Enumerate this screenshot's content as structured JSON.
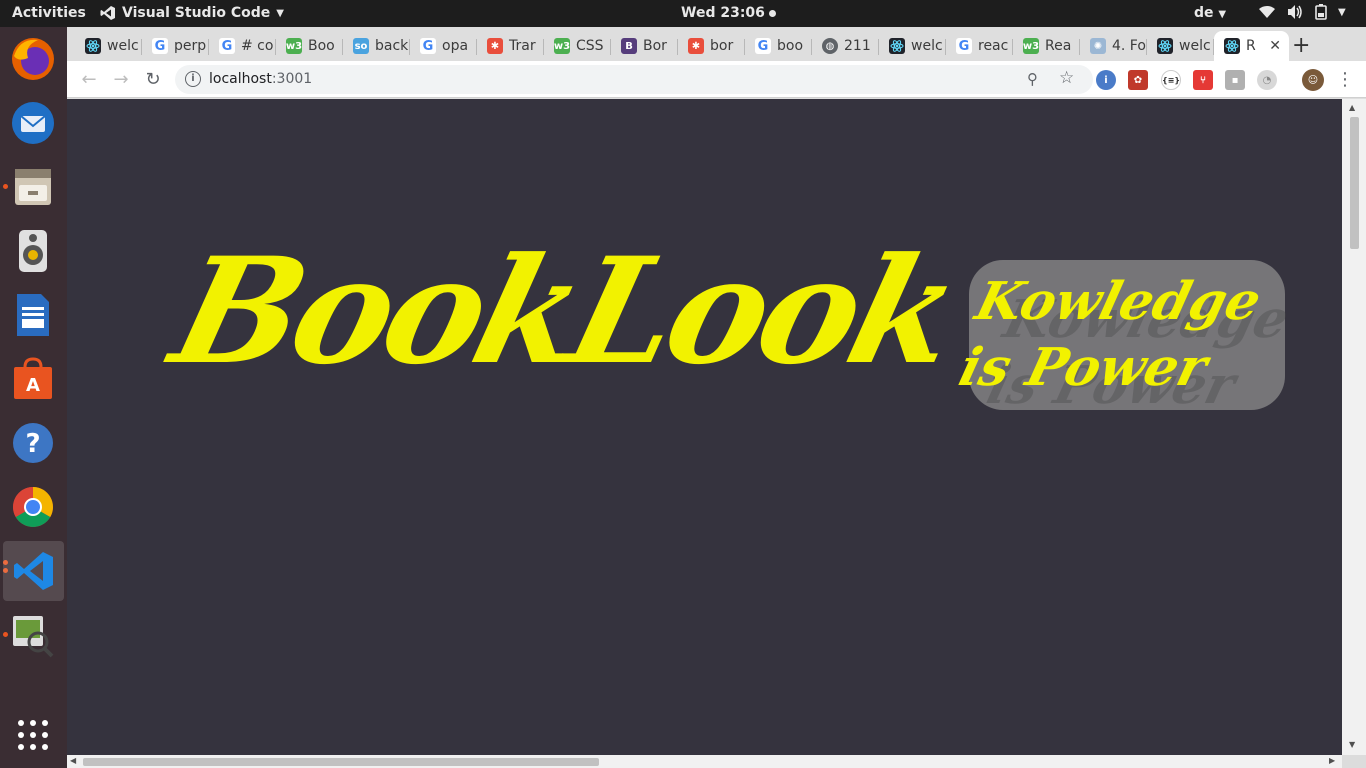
{
  "topbar": {
    "activities": "Activities",
    "app_name": "Visual Studio Code",
    "clock": "Wed 23:06",
    "language": "de"
  },
  "dock": {
    "items": [
      {
        "name": "firefox",
        "color": "#e66000"
      },
      {
        "name": "thunderbird",
        "color": "#1f6fc5"
      },
      {
        "name": "files",
        "color": "#d0c6b4"
      },
      {
        "name": "rhythmbox",
        "color": "#cccccc"
      },
      {
        "name": "libreoffice-writer",
        "color": "#2a6cc0"
      },
      {
        "name": "ubuntu-software",
        "color": "#e95420"
      },
      {
        "name": "help",
        "color": "#3d76c4"
      },
      {
        "name": "chrome",
        "color": "#4caf50"
      },
      {
        "name": "vscode",
        "color": "#1e88e5"
      },
      {
        "name": "image-viewer",
        "color": "#6a9a3a"
      },
      {
        "name": "show-applications",
        "color": "#ffffff"
      }
    ]
  },
  "tabs": [
    {
      "label": "welc",
      "fav": "react",
      "color": "#20232a"
    },
    {
      "label": "perp",
      "fav": "G",
      "color": "#ffffff"
    },
    {
      "label": "# co",
      "fav": "G",
      "color": "#ffffff"
    },
    {
      "label": "Boo",
      "fav": "w3",
      "color": "#4caf50"
    },
    {
      "label": "back",
      "fav": "so",
      "color": "#4aa3df"
    },
    {
      "label": "opa",
      "fav": "G",
      "color": "#ffffff"
    },
    {
      "label": "Trar",
      "fav": "✱",
      "color": "#e94e3c"
    },
    {
      "label": "CSS",
      "fav": "w3",
      "color": "#4caf50"
    },
    {
      "label": "Bor",
      "fav": "B",
      "color": "#563d7c"
    },
    {
      "label": "bor",
      "fav": "✱",
      "color": "#e94e3c"
    },
    {
      "label": "boo",
      "fav": "G",
      "color": "#ffffff"
    },
    {
      "label": "211",
      "fav": "globe",
      "color": "#5f6368"
    },
    {
      "label": "welc",
      "fav": "react",
      "color": "#20232a"
    },
    {
      "label": "reac",
      "fav": "G",
      "color": "#ffffff"
    },
    {
      "label": "Rea",
      "fav": "w3",
      "color": "#4caf50"
    },
    {
      "label": "4. Fo",
      "fav": "✺",
      "color": "#9bb7d4"
    },
    {
      "label": "welc",
      "fav": "react",
      "color": "#20232a"
    },
    {
      "label": "R",
      "fav": "react",
      "color": "#20232a"
    }
  ],
  "address": {
    "host": "localhost",
    "port": ":3001"
  },
  "page": {
    "logo_text": "BookLook",
    "tagline_line1": "Kowledge",
    "tagline_line2": "is Power",
    "background": "#35333e",
    "accent": "#f2f200"
  }
}
